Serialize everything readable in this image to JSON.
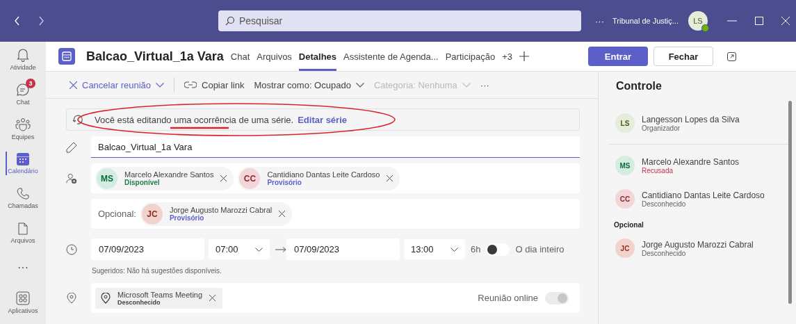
{
  "title_bar": {
    "search": {
      "placeholder": "Pesquisar"
    },
    "more": "···",
    "org": "Tribunal de Justiç...",
    "avatar": "LS"
  },
  "rail": [
    {
      "kind": "bell",
      "label": "Atividade",
      "selected": false
    },
    {
      "kind": "chat",
      "label": "Chat",
      "badge": "3",
      "selected": false
    },
    {
      "kind": "teams",
      "label": "Equipes",
      "selected": false
    },
    {
      "kind": "calendar",
      "label": "Calendário",
      "selected": true
    },
    {
      "kind": "phone",
      "label": "Chamadas",
      "selected": false
    },
    {
      "kind": "file",
      "label": "Arquivos",
      "selected": false
    },
    {
      "kind": "more",
      "label": "···",
      "selected": false
    },
    {
      "kind": "apps",
      "label": "Aplicativos",
      "selected": false
    }
  ],
  "meeting": {
    "title": "Balcao_Virtual_1a Vara",
    "tabs": [
      {
        "label": "Chat",
        "selected": false
      },
      {
        "label": "Arquivos",
        "selected": false
      },
      {
        "label": "Detalhes",
        "selected": true
      },
      {
        "label": "Assistente de Agenda...",
        "selected": false
      },
      {
        "label": "Participação",
        "selected": false
      },
      {
        "label": "+3",
        "selected": false
      }
    ],
    "join": "Entrar",
    "close": "Fechar"
  },
  "toolbar": [
    {
      "kind": "cancel",
      "label": "Cancelar reunião"
    },
    {
      "kind": "link",
      "label": "Copiar link"
    },
    {
      "kind": "dropdown",
      "label": "Mostrar como: Ocupado",
      "disabled": false
    },
    {
      "kind": "dropdown",
      "label": "Categoria: Nenhuma",
      "disabled": true
    },
    {
      "kind": "more",
      "label": "···"
    }
  ],
  "banner": {
    "text": "Você está editando uma ocorrência de uma série.",
    "link": "Editar série"
  },
  "form": {
    "title_value": "Balcao_Virtual_1a Vara",
    "required": [
      {
        "initials": "MS",
        "name": "Marcelo Alexandre Santos",
        "color": "#d3ede0",
        "status": {
          "text": "Disponível",
          "color": "#237b4b"
        }
      },
      {
        "initials": "CC",
        "name": "Cantidiano Dantas Leite Cardoso",
        "color": "#f3d6d8",
        "status": {
          "text": "Provisório",
          "color": "#5b5fc7"
        }
      }
    ],
    "optional_label": "Opcional:",
    "optional": [
      {
        "initials": "JC",
        "name": "Jorge Augusto Marozzi Cabral",
        "color": "#f2d2cd",
        "status": {
          "text": "Provisório",
          "color": "#5b5fc7"
        }
      }
    ],
    "start_date": "07/09/2023",
    "start_time": "07:00",
    "end_date": "07/09/2023",
    "end_time": "13:00",
    "duration": "6h",
    "all_day": {
      "label": "O dia inteiro",
      "on": false
    },
    "suggestions": "Sugeridos: Não há sugestões disponíveis.",
    "location": {
      "name": "Microsoft Teams Meeting",
      "status": "Desconhecido"
    },
    "online": {
      "label": "Reunião online",
      "on": true,
      "disabled": true
    }
  },
  "panel": {
    "title": "Controle",
    "groups": [
      {
        "people": [
          {
            "initials": "LS",
            "name": "Langesson Lopes da Silva",
            "color": "#e5ecd9",
            "status": {
              "text": "Organizador",
              "color": "#616161"
            }
          }
        ]
      },
      {
        "people": [
          {
            "initials": "MS",
            "name": "Marcelo Alexandre Santos",
            "color": "#d3ede0",
            "status": {
              "text": "Recusada",
              "color": "#c4314b"
            }
          },
          {
            "initials": "CC",
            "name": "Cantidiano Dantas Leite Cardoso",
            "color": "#f3d6d8",
            "status": {
              "text": "Desconhecido",
              "color": "#616161"
            }
          }
        ]
      },
      {
        "heading": "Opcional",
        "people": [
          {
            "initials": "JC",
            "name": "Jorge Augusto Marozzi Cabral",
            "color": "#f2d2cd",
            "status": {
              "text": "Desconhecido",
              "color": "#616161"
            }
          }
        ]
      }
    ]
  }
}
